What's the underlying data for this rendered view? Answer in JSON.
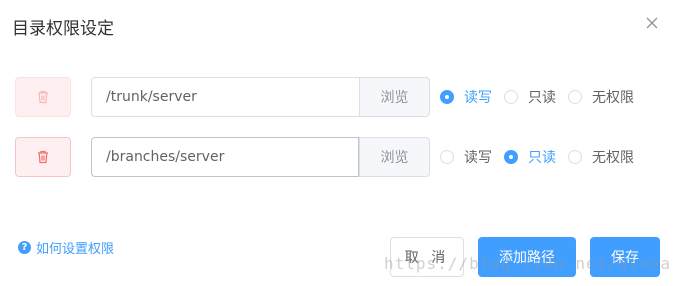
{
  "dialog": {
    "title": "目录权限设定"
  },
  "rows": [
    {
      "path": "/trunk/server",
      "browse_label": "浏览",
      "delete_enabled": false,
      "options": [
        {
          "label": "读写",
          "checked": true
        },
        {
          "label": "只读",
          "checked": false
        },
        {
          "label": "无权限",
          "checked": false
        }
      ]
    },
    {
      "path": "/branches/server",
      "browse_label": "浏览",
      "delete_enabled": true,
      "options": [
        {
          "label": "读写",
          "checked": false
        },
        {
          "label": "只读",
          "checked": true
        },
        {
          "label": "无权限",
          "checked": false
        }
      ]
    }
  ],
  "footer": {
    "help_link": "如何设置权限",
    "cancel_label": "取 消",
    "add_path_label": "添加路径",
    "save_label": "保存"
  },
  "watermark": "https://blog.csdn.net/atsoar",
  "colors": {
    "primary": "#409eff",
    "danger_light": "#fef0f0",
    "danger": "#f56c6c",
    "text": "#303133",
    "border": "#dcdfe6"
  },
  "icons": {
    "close": "close-icon",
    "delete": "trash-icon",
    "help": "question-circle-icon"
  }
}
